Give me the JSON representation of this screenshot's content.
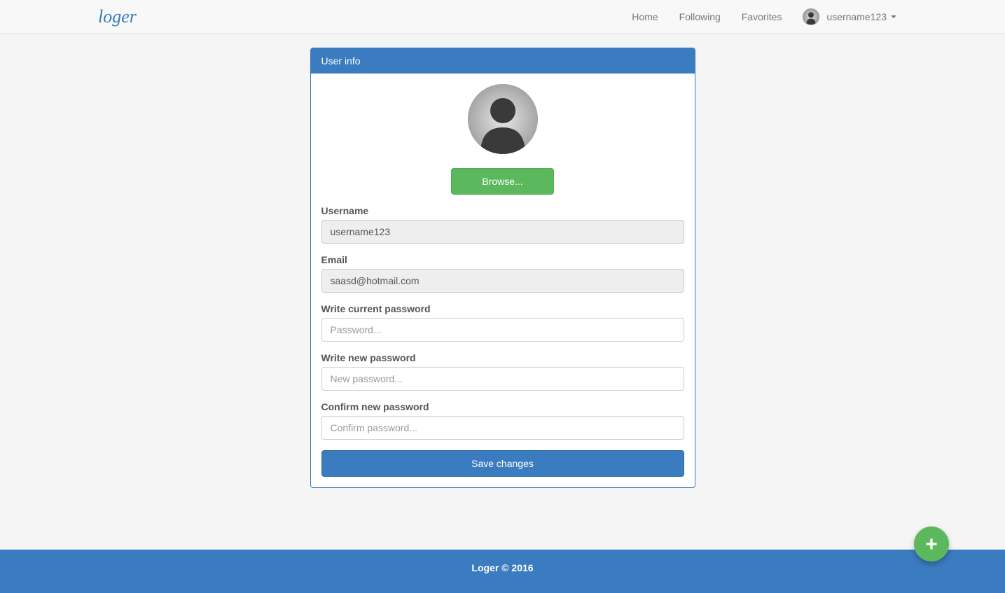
{
  "nav": {
    "brand": "loger",
    "links": [
      "Home",
      "Following",
      "Favorites"
    ],
    "username": "username123"
  },
  "panel": {
    "title": "User info",
    "browse_label": "Browse...",
    "fields": {
      "username": {
        "label": "Username",
        "value": "username123"
      },
      "email": {
        "label": "Email",
        "value": "saasd@hotmail.com"
      },
      "current_pw": {
        "label": "Write current password",
        "placeholder": "Password..."
      },
      "new_pw": {
        "label": "Write new password",
        "placeholder": "New password..."
      },
      "confirm_pw": {
        "label": "Confirm new password",
        "placeholder": "Confirm password..."
      }
    },
    "save_label": "Save changes"
  },
  "footer": {
    "text": "Loger © 2016"
  }
}
